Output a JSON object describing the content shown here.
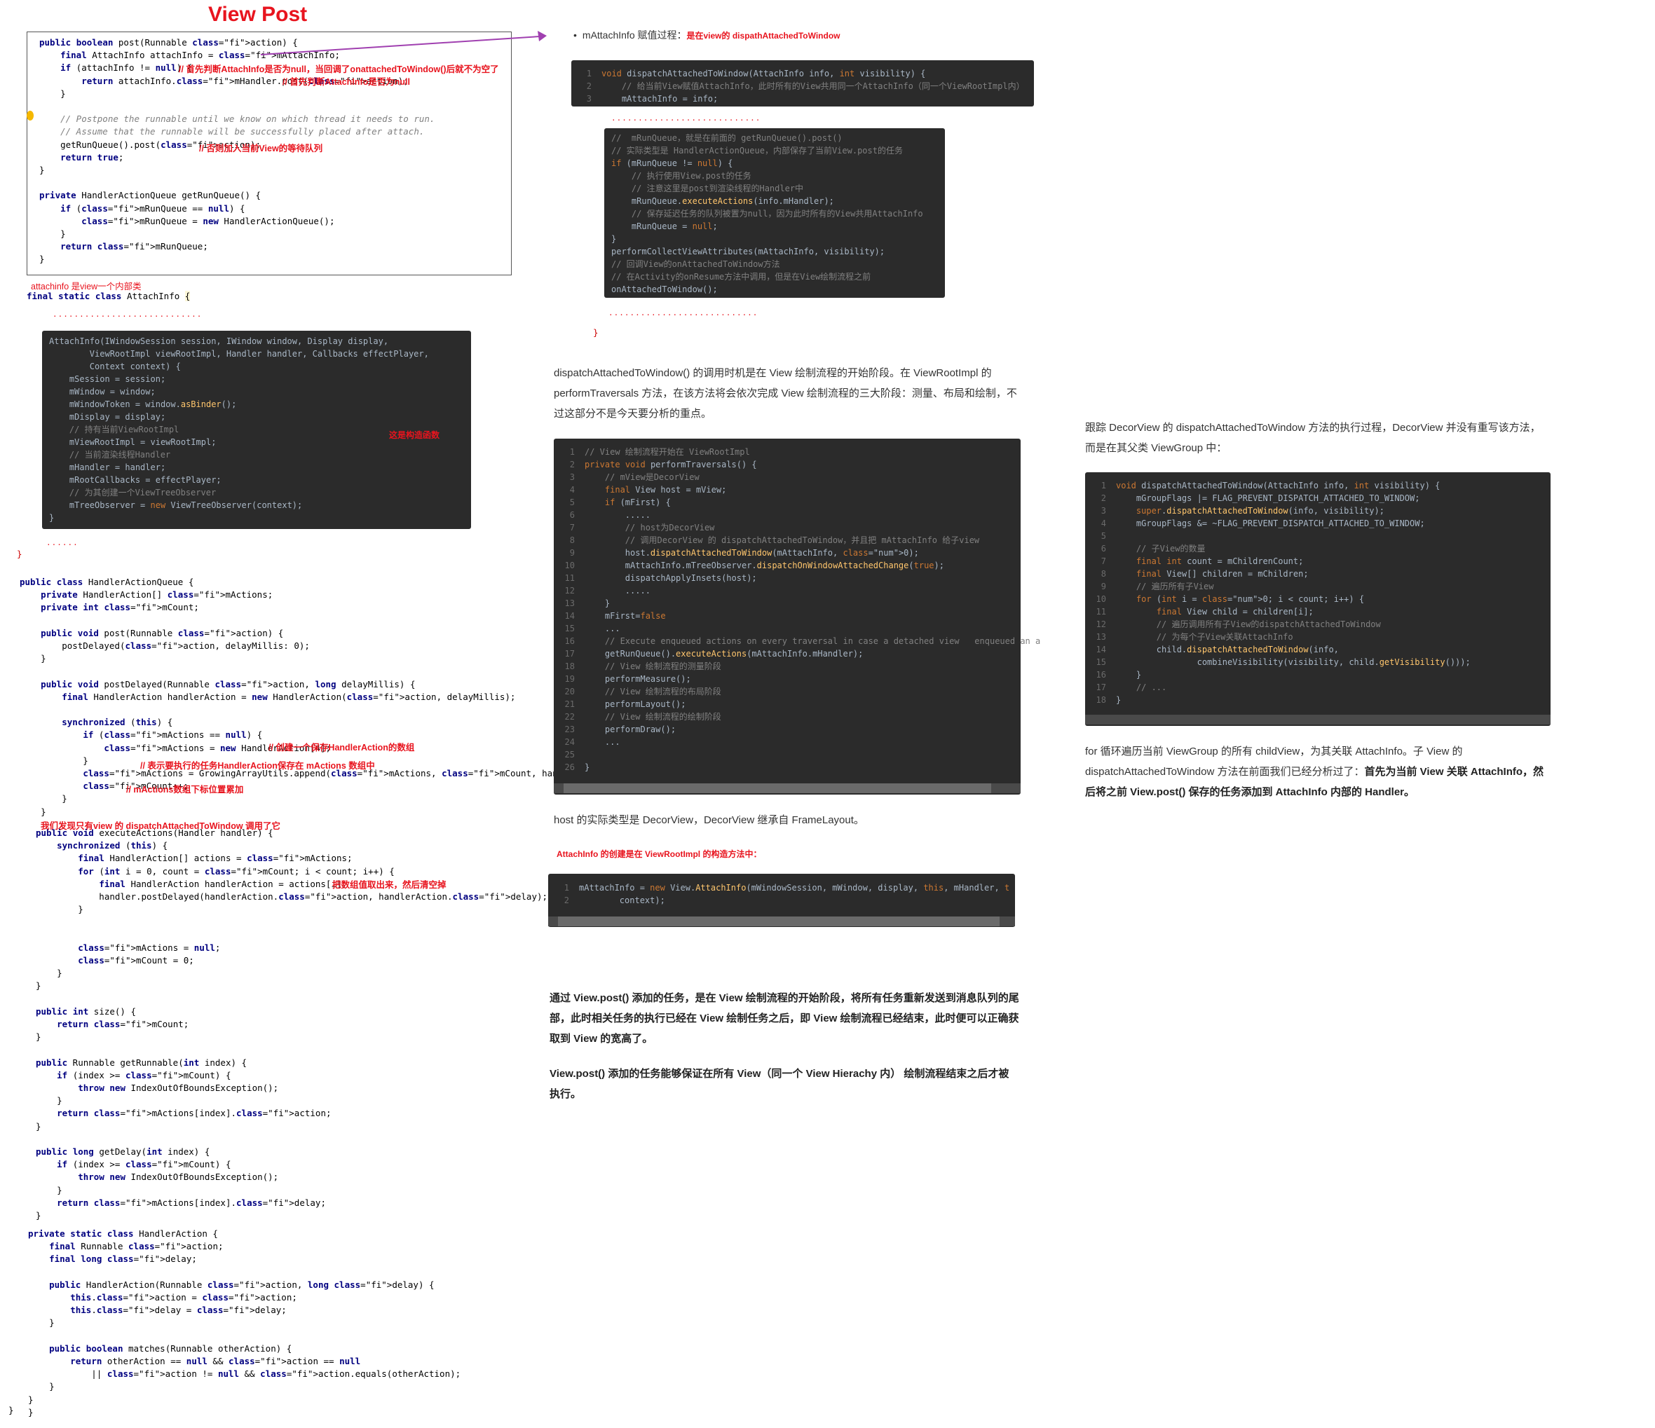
{
  "title": "View Post",
  "box1": {
    "lines": [
      "public boolean post(Runnable action) {",
      "    final AttachInfo attachInfo = mAttachInfo;",
      "    if (attachInfo != null) {",
      "        return attachInfo.mHandler.post(action);",
      "    }",
      "",
      "    // Postpone the runnable until we know on which thread it needs to run.",
      "    // Assume that the runnable will be successfully placed after attach.",
      "    getRunQueue().post(action);",
      "    return true;",
      "}",
      "",
      "private HandlerActionQueue getRunQueue() {",
      "    if (mRunQueue == null) {",
      "        mRunQueue = new HandlerActionQueue();",
      "    }",
      "    return mRunQueue;",
      "}"
    ],
    "note1": "// 首先判断AttachInfo是否为null，当回调了onattachedToWindow()后就不为空了",
    "note2": "// 首先判断AttachInfo是否为null",
    "note3": "// 否则加入当前View的等待队列"
  },
  "attachinfo_note": "attachinfo 是view一个内部类",
  "attachinfo_decl": "final static class AttachInfo {",
  "dots1": "............................",
  "attach_code": [
    "AttachInfo(IWindowSession session, IWindow window, Display display,",
    "        ViewRootImpl viewRootImpl, Handler handler, Callbacks effectPlayer,",
    "        Context context) {",
    "    mSession = session;",
    "    mWindow = window;",
    "    mWindowToken = window.asBinder();",
    "    mDisplay = display;",
    "    // 持有当前ViewRootImpl",
    "    mViewRootImpl = viewRootImpl;",
    "    // 当前渲染线程Handler",
    "    mHandler = handler;",
    "    mRootCallbacks = effectPlayer;",
    "    // 为其创建一个ViewTreeObserver",
    "    mTreeObserver = new ViewTreeObserver(context);",
    "}"
  ],
  "attach_note": "这是构造函数",
  "dots2": "......",
  "closing_brace": "}",
  "queue_code": {
    "header": [
      "public class HandlerActionQueue {",
      "    private HandlerAction[] mActions;",
      "    private int mCount;",
      "",
      "    public void post(Runnable action) {",
      "        postDelayed(action, delayMillis: 0);",
      "    }",
      "",
      "    public void postDelayed(Runnable action, long delayMillis) {",
      "        final HandlerAction handlerAction = new HandlerAction(action, delayMillis);",
      "",
      "        synchronized (this) {",
      "            if (mActions == null) {",
      "                mActions = new HandlerAction[4];",
      "            }",
      "            mActions = GrowingArrayUtils.append(mActions, mCount, handlerAction);",
      "            mCount++;",
      "        }",
      "    }"
    ],
    "note_create": "// 创建一个保存HandlerAction的数组",
    "note_task": "// 表示要执行的任务HandlerAction保存在 mActions 数组中",
    "note_count": "// mActions数组下标位置累加",
    "note_dispatch": "我们发现只有view 的 dispatchAttachedToWindow 调用了它",
    "execute": [
      "public void executeActions(Handler handler) {",
      "    synchronized (this) {",
      "        final HandlerAction[] actions = mActions;",
      "        for (int i = 0, count = mCount; i < count; i++) {",
      "            final HandlerAction handlerAction = actions[i];",
      "            handler.postDelayed(handlerAction.action, handlerAction.delay);",
      "        }",
      "",
      "",
      "        mActions = null;",
      "        mCount = 0;",
      "    }",
      "}",
      "",
      "public int size() {",
      "    return mCount;",
      "}",
      "",
      "public Runnable getRunnable(int index) {",
      "    if (index >= mCount) {",
      "        throw new IndexOutOfBoundsException();",
      "    }",
      "    return mActions[index].action;",
      "}",
      "",
      "public long getDelay(int index) {",
      "    if (index >= mCount) {",
      "        throw new IndexOutOfBoundsException();",
      "    }",
      "    return mActions[index].delay;",
      "}"
    ],
    "note_exec": "把数组值取出来，然后清空掉",
    "inner": [
      "private static class HandlerAction {",
      "    final Runnable action;",
      "    final long delay;",
      "",
      "    public HandlerAction(Runnable action, long delay) {",
      "        this.action = action;",
      "        this.delay = delay;",
      "    }",
      "",
      "    public boolean matches(Runnable otherAction) {",
      "        return otherAction == null && action == null",
      "            || action != null && action.equals(otherAction);",
      "    }",
      "}",
      "}"
    ]
  },
  "middle": {
    "bullet": "mAttachInfo 赋值过程：",
    "bullet_red": "是在view的 dispathAttachedToWindow",
    "code1": [
      "void dispatchAttachedToWindow(AttachInfo info, int visibility) {",
      "    // 给当前View赋值AttachInfo，此时所有的View共用同一个AttachInfo（同一个ViewRootImpl内）",
      "    mAttachInfo = info;"
    ],
    "code2": [
      "//  mRunQueue，就是在前面的 getRunQueue().post()",
      "// 实际类型是 HandlerActionQueue，内部保存了当前View.post的任务",
      "if (mRunQueue != null) {",
      "    // 执行使用View.post的任务",
      "    // 注意这里是post到渲染线程的Handler中",
      "    mRunQueue.executeActions(info.mHandler);",
      "    // 保存延迟任务的队列被置为null，因为此时所有的View共用AttachInfo",
      "    mRunQueue = null;",
      "}",
      "performCollectViewAttributes(mAttachInfo, visibility);",
      "// 回调View的onAttachedToWindow方法",
      "// 在Activity的onResume方法中调用，但是在View绘制流程之前",
      "onAttachedToWindow();"
    ],
    "brace": "}",
    "para1": "dispatchAttachedToWindow() 的调用时机是在 View 绘制流程的开始阶段。在 ViewRootImpl 的 performTraversals 方法，在该方法将会依次完成 View 绘制流程的三大阶段：测量、布局和绘制，不过这部分不是今天要分析的重点。",
    "code3": [
      "// View 绘制流程开始在 ViewRootImpl",
      "private void performTraversals() {",
      "    // mView是DecorView",
      "    final View host = mView;",
      "    if (mFirst) {",
      "        .....",
      "        // host为DecorView",
      "        // 调用DecorView 的 dispatchAttachedToWindow，并且把 mAttachInfo 给子view",
      "        host.dispatchAttachedToWindow(mAttachInfo, 0);",
      "        mAttachInfo.mTreeObserver.dispatchOnWindowAttachedChange(true);",
      "        dispatchApplyInsets(host);",
      "        .....",
      "    }",
      "    mFirst=false",
      "    ...",
      "    // Execute enqueued actions on every traversal in case a detached view   enqueued an a",
      "    getRunQueue().executeActions(mAttachInfo.mHandler);",
      "    // View 绘制流程的测量阶段",
      "    performMeasure();",
      "    // View 绘制流程的布局阶段",
      "    performLayout();",
      "    // View 绘制流程的绘制阶段",
      "    performDraw();",
      "    ...",
      "",
      "}"
    ],
    "para2": "host 的实际类型是 DecorView，DecorView 继承自 FrameLayout。",
    "red_note": "AttachInfo 的创建是在 ViewRootImpl 的构造方法中：",
    "code4": [
      "mAttachInfo = new View.AttachInfo(mWindowSession, mWindow, display, this, mHandler, this,",
      "        context);"
    ],
    "para3": "通过 View.post() 添加的任务，是在 View 绘制流程的开始阶段，将所有任务重新发送到消息队列的尾部，此时相关任务的执行已经在 View 绘制任务之后，即 View 绘制流程已经结束，此时便可以正确获取到 View 的宽高了。",
    "para4": "View.post() 添加的任务能够保证在所有 View（同一个 View Hierachy 内） 绘制流程结束之后才被执行。"
  },
  "right": {
    "para1": "跟踪 DecorView 的 dispatchAttachedToWindow 方法的执行过程，DecorView 并没有重写该方法，而是在其父类 ViewGroup 中：",
    "code": [
      "void dispatchAttachedToWindow(AttachInfo info, int visibility) {",
      "    mGroupFlags |= FLAG_PREVENT_DISPATCH_ATTACHED_TO_WINDOW;",
      "    super.dispatchAttachedToWindow(info, visibility);",
      "    mGroupFlags &= ~FLAG_PREVENT_DISPATCH_ATTACHED_TO_WINDOW;",
      "",
      "    // 子View的数量",
      "    final int count = mChildrenCount;",
      "    final View[] children = mChildren;",
      "    // 遍历所有子View",
      "    for (int i = 0; i < count; i++) {",
      "        final View child = children[i];",
      "        // 遍历调用所有子View的dispatchAttachedToWindow",
      "        // 为每个子View关联AttachInfo",
      "        child.dispatchAttachedToWindow(info,",
      "                combineVisibility(visibility, child.getVisibility()));",
      "    }",
      "    // ...",
      "}"
    ],
    "para2a": "for 循环遍历当前 ViewGroup 的所有 childView，为其关联 AttachInfo。子 View 的 dispatchAttachedToWindow 方法在前面我们已经分析过了：",
    "para2b": "首先为当前 View 关联 AttachInfo，然后将之前 View.post() 保存的任务添加到 AttachInfo 内部的 Handler。"
  }
}
